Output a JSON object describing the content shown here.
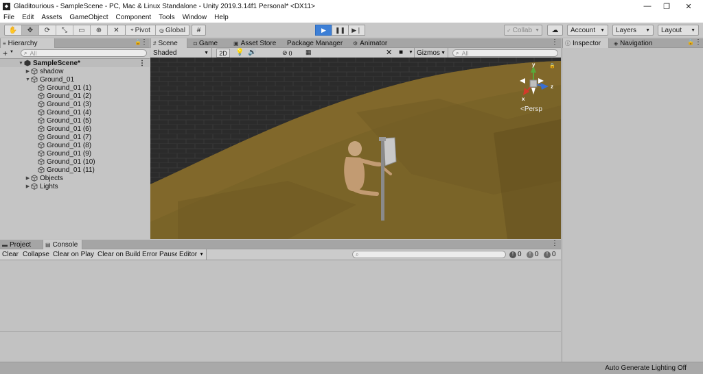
{
  "window": {
    "title": "Gladitourious - SampleScene - PC, Mac & Linux Standalone - Unity 2019.3.14f1 Personal* <DX11>",
    "minimize": "—",
    "maximize": "❐",
    "close": "✕"
  },
  "menu": [
    "File",
    "Edit",
    "Assets",
    "GameObject",
    "Component",
    "Tools",
    "Window",
    "Help"
  ],
  "toolbar": {
    "pivot_label": "Pivot",
    "global_label": "Global",
    "collab_label": "Collab",
    "account_label": "Account",
    "layers_label": "Layers",
    "layout_label": "Layout",
    "play_active": true
  },
  "hierarchy": {
    "tab_label": "Hierarchy",
    "search_placeholder": "All",
    "add_label": "+",
    "items": [
      {
        "label": "SampleScene*",
        "depth": 0,
        "fold": "▼",
        "type": "scene"
      },
      {
        "label": "shadow",
        "depth": 1,
        "fold": "▶",
        "type": "object"
      },
      {
        "label": "Ground_01",
        "depth": 1,
        "fold": "▼",
        "type": "object"
      },
      {
        "label": "Ground_01 (1)",
        "depth": 2,
        "fold": "",
        "type": "object"
      },
      {
        "label": "Ground_01 (2)",
        "depth": 2,
        "fold": "",
        "type": "object"
      },
      {
        "label": "Ground_01 (3)",
        "depth": 2,
        "fold": "",
        "type": "object"
      },
      {
        "label": "Ground_01 (4)",
        "depth": 2,
        "fold": "",
        "type": "object"
      },
      {
        "label": "Ground_01 (5)",
        "depth": 2,
        "fold": "",
        "type": "object"
      },
      {
        "label": "Ground_01 (6)",
        "depth": 2,
        "fold": "",
        "type": "object"
      },
      {
        "label": "Ground_01 (7)",
        "depth": 2,
        "fold": "",
        "type": "object"
      },
      {
        "label": "Ground_01 (8)",
        "depth": 2,
        "fold": "",
        "type": "object"
      },
      {
        "label": "Ground_01 (9)",
        "depth": 2,
        "fold": "",
        "type": "object"
      },
      {
        "label": "Ground_01 (10)",
        "depth": 2,
        "fold": "",
        "type": "object"
      },
      {
        "label": "Ground_01 (11)",
        "depth": 2,
        "fold": "",
        "type": "object"
      },
      {
        "label": "Objects",
        "depth": 1,
        "fold": "▶",
        "type": "object"
      },
      {
        "label": "Lights",
        "depth": 1,
        "fold": "▶",
        "type": "object"
      }
    ]
  },
  "scene": {
    "tabs": [
      "Scene",
      "Game",
      "Asset Store",
      "Package Manager",
      "Animator"
    ],
    "shading_mode": "Shaded",
    "mode_2d": "2D",
    "fx_count": "0",
    "gizmos_label": "Gizmos",
    "search_placeholder": "All",
    "persp_label": "<Persp",
    "axis_labels": {
      "x": "x",
      "y": "y",
      "z": "z"
    }
  },
  "console": {
    "tabs": [
      "Project",
      "Console"
    ],
    "buttons": [
      "Clear",
      "Collapse",
      "Clear on Play",
      "Clear on Build",
      "Error Pause"
    ],
    "editor_label": "Editor",
    "counts": {
      "info": "0",
      "warning": "0",
      "error": "0"
    }
  },
  "inspector": {
    "tabs": [
      "Inspector",
      "Navigation"
    ]
  },
  "status": {
    "text": "Auto Generate Lighting Off"
  },
  "colors": {
    "play_blue": "#3d7fd6",
    "ground": "#7a6428",
    "wall": "#2a2a2a"
  }
}
